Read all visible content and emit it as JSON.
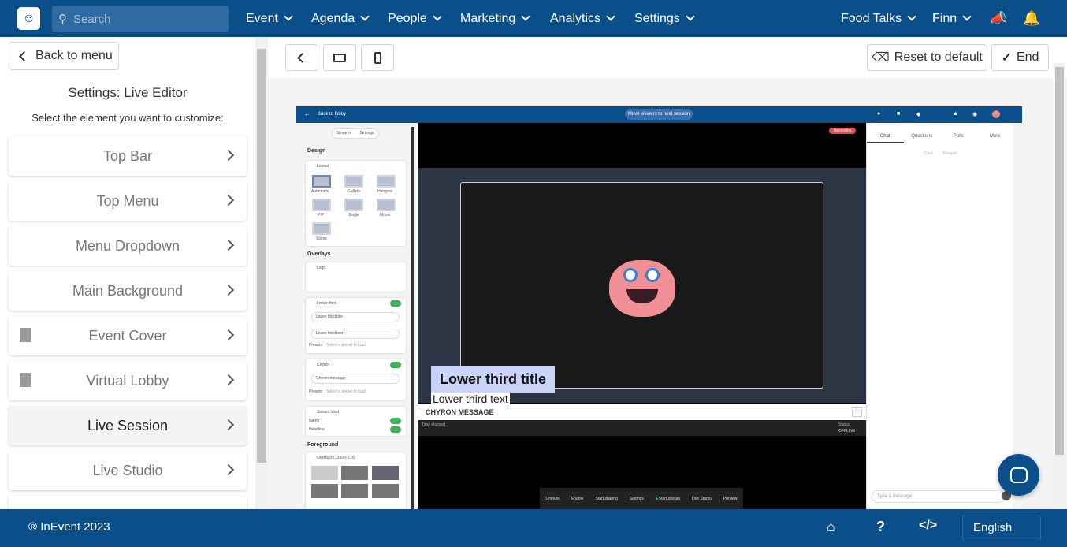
{
  "app": {
    "search_placeholder": "Search",
    "nav": [
      "Event",
      "Agenda",
      "People",
      "Marketing",
      "Analytics",
      "Settings"
    ],
    "event_name": "Food Talks",
    "user": "Finn"
  },
  "sidebar": {
    "back_label": "Back to menu",
    "title": "Settings: Live Editor",
    "subtitle": "Select the element you want to customize:",
    "items": [
      {
        "label": "Top Bar",
        "icon": ""
      },
      {
        "label": "Top Menu",
        "icon": ""
      },
      {
        "label": "Menu Dropdown",
        "icon": ""
      },
      {
        "label": "Main Background",
        "icon": ""
      },
      {
        "label": "Event Cover",
        "icon": "document-icon"
      },
      {
        "label": "Virtual Lobby",
        "icon": "document-icon"
      },
      {
        "label": "Live Session",
        "icon": "",
        "active": true
      },
      {
        "label": "Live Studio",
        "icon": ""
      }
    ]
  },
  "toolbar": {
    "reset_label": "Reset to default",
    "end_label": "End"
  },
  "preview": {
    "back_to_lobby": "Back to lobby",
    "move_viewers": "Move viewers to next session",
    "recording": "Recording",
    "left_tabs": [
      "Streams",
      "Settings"
    ],
    "design_label": "Design",
    "layout_label": "Layout",
    "layouts": [
      "Automatic",
      "Gallery",
      "Hangout",
      "PIP",
      "Single",
      "Movie",
      "Slides"
    ],
    "overlays_label": "Overlays",
    "logo_label": "Logo",
    "lower_third_label": "Lower third",
    "lower_third_title_placeholder": "Lower third title",
    "lower_third_text_placeholder": "Lower third text",
    "presets_label": "Presets",
    "preset_placeholder": "Select a preset to load",
    "chyron_label": "Chyron",
    "chyron_placeholder": "Chyron message",
    "stream_label": "Stream label",
    "name_label": "Name",
    "headline_label": "Headline",
    "foreground_label": "Foreground",
    "overlays_size": "Overlays (1280 x 720)",
    "lower_third_title": "Lower third title",
    "lower_third_text": "Lower third text",
    "chyron_message": "CHYRON MESSAGE",
    "time_elapsed": "Time elapsed",
    "status_label": "Status",
    "status_value": "OFFLINE",
    "controls": [
      "Unmute",
      "Enable",
      "Start sharing",
      "Settings",
      "Start stream",
      "Live Studio",
      "Preview"
    ],
    "right_tabs": [
      "Chat",
      "Questions",
      "Polls",
      "More"
    ],
    "chat_subtabs": [
      "Chat",
      "Whisper"
    ],
    "message_placeholder": "Type a message"
  },
  "footer": {
    "copyright": "® InEvent 2023",
    "language": "English"
  },
  "colors": {
    "brand": "#0b4f8a",
    "accent": "#3cb356"
  }
}
